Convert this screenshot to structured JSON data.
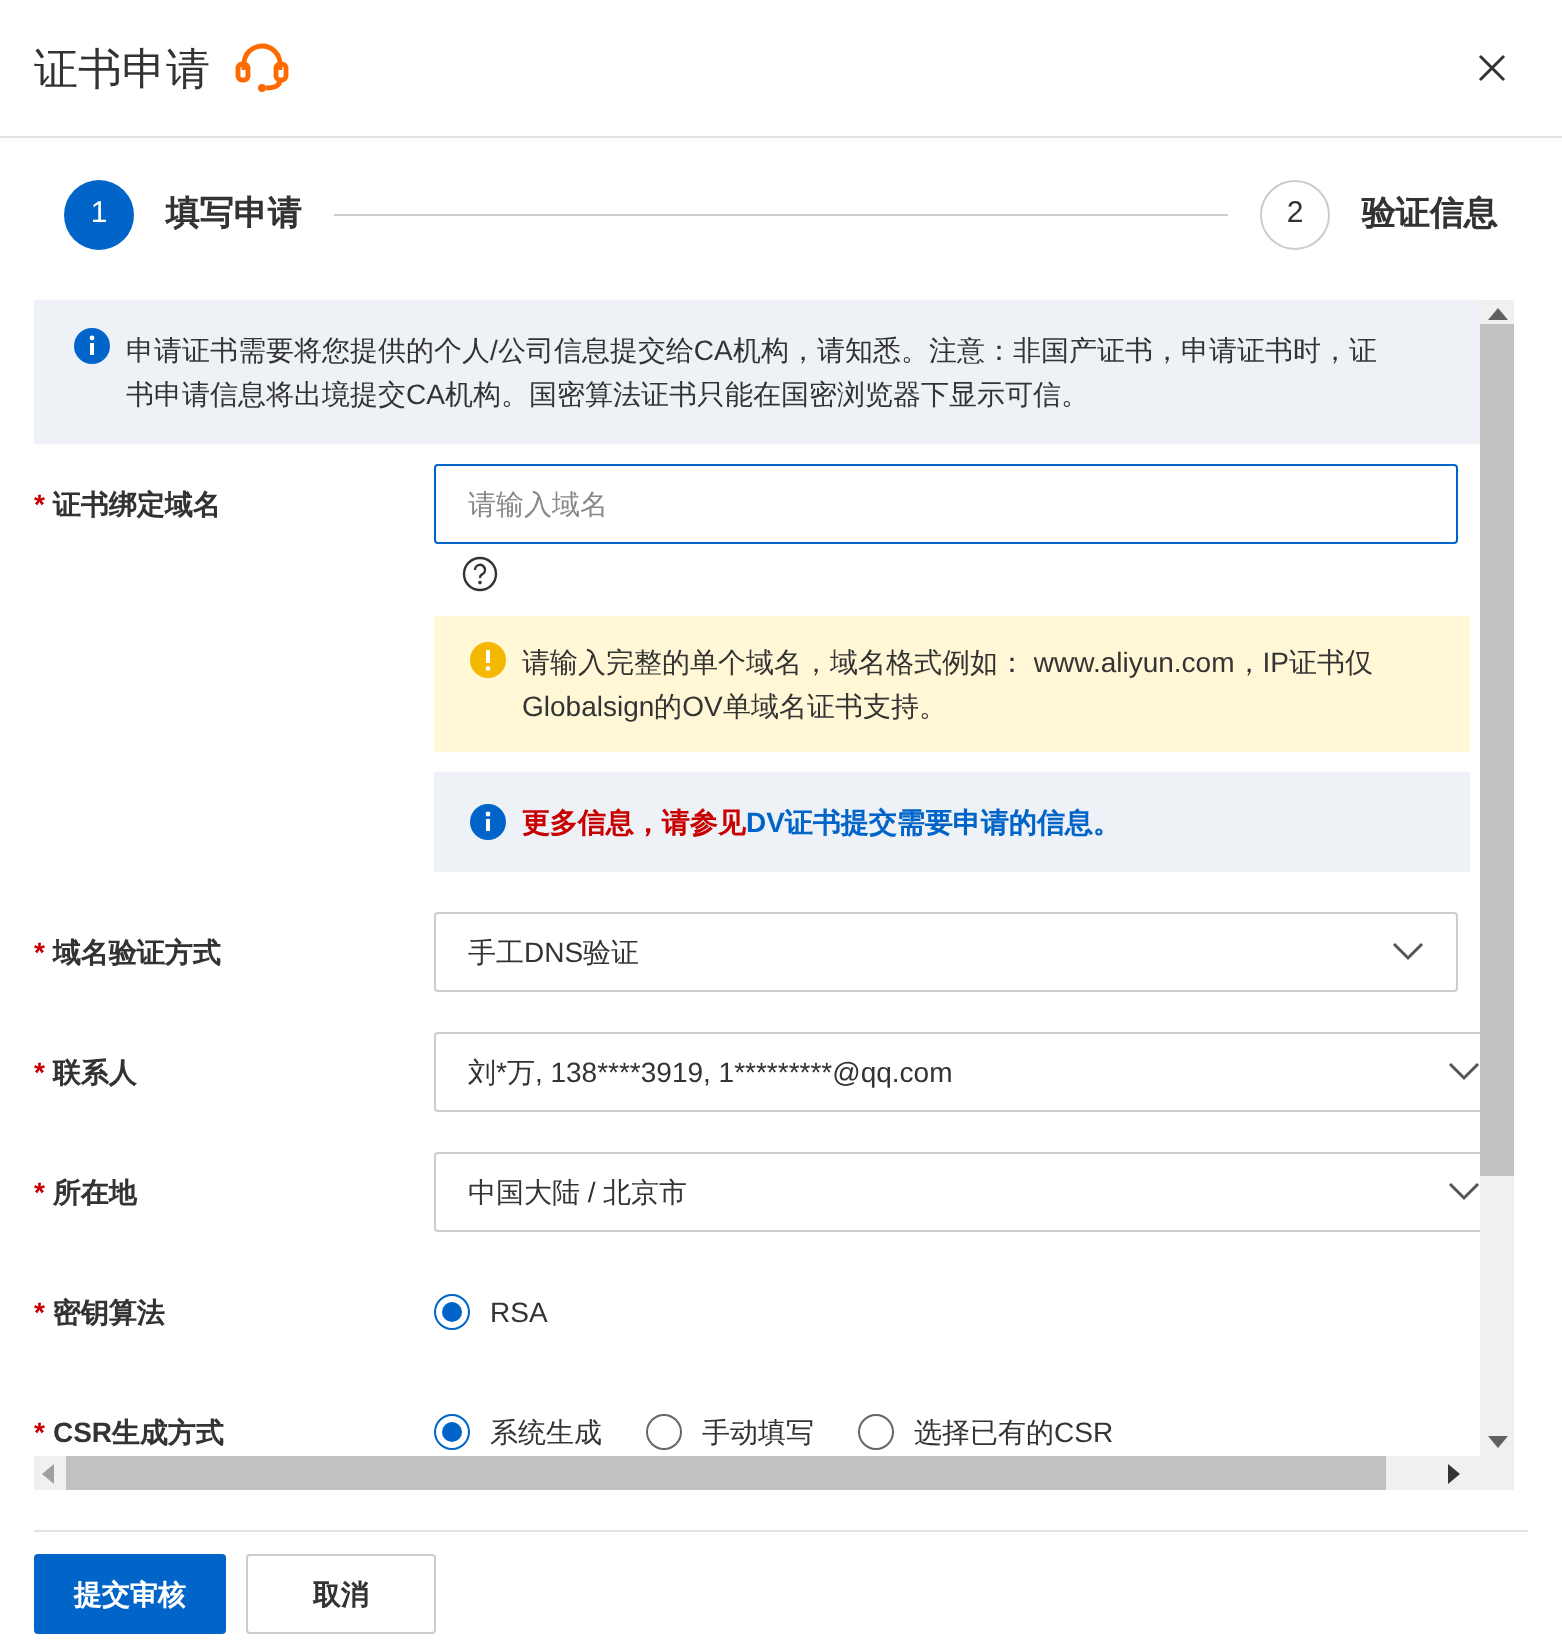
{
  "dialog": {
    "title": "证书申请"
  },
  "steps": [
    {
      "number": "1",
      "label": "填写申请",
      "selected": true
    },
    {
      "number": "2",
      "label": "验证信息",
      "selected": false
    }
  ],
  "notice": "申请证书需要将您提供的个人/公司信息提交给CA机构，请知悉。注意：非国产证书，申请证书时，证书申请信息将出境提交CA机构。国密算法证书只能在国密浏览器下显示可信。",
  "fields": [
    {
      "kind": "input",
      "marker": "*",
      "label": "证书绑定域名",
      "placeholder": "请输入域名",
      "warning": "请输入完整的单个域名，域名格式例如： www.aliyun.com，IP证书仅Globalsign的OV单域名证书支持。",
      "info": {
        "text": "更多信息，请参见",
        "link": "DV证书提交需要申请的信息。"
      }
    },
    {
      "kind": "select",
      "marker": "*",
      "label": "域名验证方式",
      "value": "手工DNS验证"
    },
    {
      "kind": "select",
      "marker": "*",
      "label": "联系人",
      "value": "刘*万, 138****3919, 1*********@qq.com"
    },
    {
      "kind": "select",
      "marker": "*",
      "label": "所在地",
      "value": "中国大陆 / 北京市"
    },
    {
      "kind": "radio",
      "marker": "*",
      "label": "密钥算法",
      "options": [
        {
          "label": "RSA",
          "selected": true
        }
      ]
    },
    {
      "kind": "radio",
      "marker": "*",
      "label": "CSR生成方式",
      "options": [
        {
          "label": "系统生成",
          "selected": true
        },
        {
          "label": "手动填写",
          "selected": false
        },
        {
          "label": "选择已有的CSR",
          "selected": false
        }
      ]
    }
  ],
  "buttons": [
    {
      "label": "提交审核",
      "kind": "primary"
    },
    {
      "label": "取消",
      "kind": "default"
    }
  ]
}
